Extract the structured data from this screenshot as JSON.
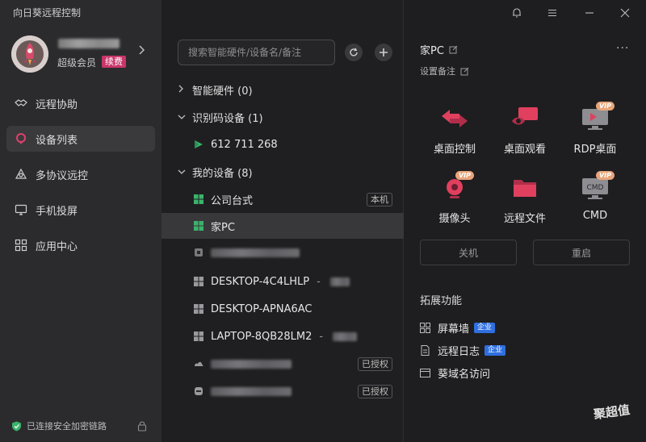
{
  "app": {
    "title": "向日葵远程控制"
  },
  "profile": {
    "member_label": "超级会员",
    "renew_label": "续费"
  },
  "nav": {
    "items": [
      {
        "label": "远程协助",
        "icon": "handshake-icon"
      },
      {
        "label": "设备列表",
        "icon": "location-pin-icon",
        "active": true
      },
      {
        "label": "多协议远控",
        "icon": "network-triangle-icon"
      },
      {
        "label": "手机投屏",
        "icon": "screen-cast-icon"
      },
      {
        "label": "应用中心",
        "icon": "app-grid-icon"
      }
    ]
  },
  "footer": {
    "secure_text": "已连接安全加密链路"
  },
  "search": {
    "placeholder": "搜索智能硬件/设备名/备注"
  },
  "groups": {
    "smart_hw": "智能硬件 (0)",
    "id_devices": "识别码设备 (1)",
    "my_devices": "我的设备 (8)"
  },
  "devices": {
    "id_code": "612 711 268",
    "office": {
      "name": "公司台式",
      "tag": "本机"
    },
    "home": {
      "name": "家PC"
    },
    "desktop1": {
      "name": "DESKTOP-4C4LHLP",
      "sep": "-"
    },
    "desktop2": {
      "name": "DESKTOP-APNA6AC"
    },
    "laptop": {
      "name": "LAPTOP-8QB28LM2",
      "sep": "-"
    },
    "blur_row1_tag": "已授权",
    "blur_row2_tag": "已授权"
  },
  "detail": {
    "title": "家PC",
    "note_label": "设置备注",
    "more": "···",
    "actions": {
      "desktop_control": "桌面控制",
      "desktop_view": "桌面观看",
      "rdp": "RDP桌面",
      "camera": "摄像头",
      "remote_file": "远程文件",
      "cmd": "CMD",
      "cmd_icon_text": "CMD",
      "vip": "VIP"
    },
    "shutdown": "关机",
    "restart": "重启",
    "ext_title": "拓展功能",
    "ext_items": {
      "screen_wall": "屏幕墙",
      "remote_log": "远程日志",
      "domain": "葵域名访问",
      "enterprise": "企业"
    }
  },
  "watermark": "聚超值",
  "colors": {
    "accent": "#c9356a",
    "enterprise": "#2f6fe0",
    "vip": "#e8a57a"
  }
}
